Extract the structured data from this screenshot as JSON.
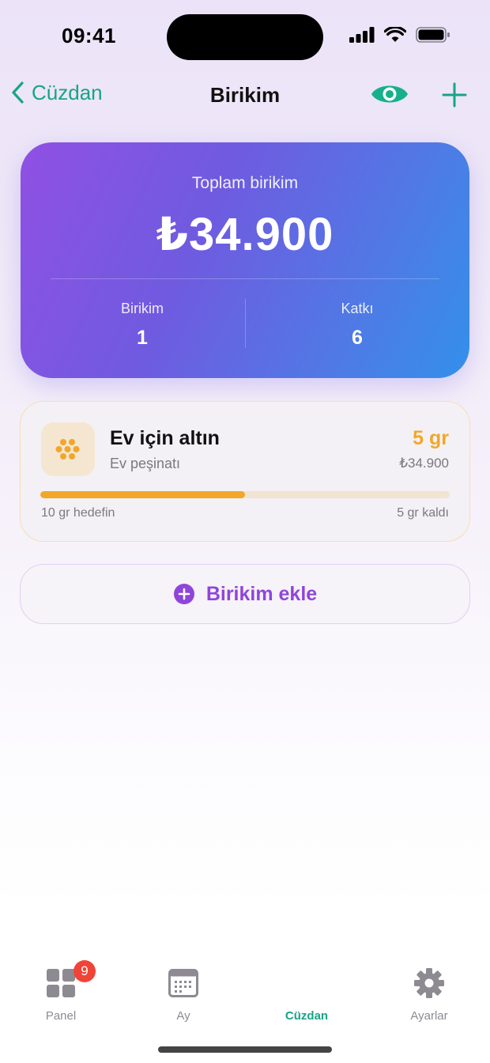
{
  "status_bar": {
    "time": "09:41"
  },
  "nav": {
    "back_label": "Cüzdan",
    "title": "Birikim"
  },
  "summary": {
    "label": "Toplam birikim",
    "amount": "₺34.900",
    "stats": [
      {
        "label": "Birikim",
        "value": "1"
      },
      {
        "label": "Katkı",
        "value": "6"
      }
    ]
  },
  "savings_item": {
    "title": "Ev için altın",
    "subtitle": "Ev peşinatı",
    "amount": "5 gr",
    "value": "₺34.900",
    "progress": 0.5,
    "goal_text": "10 gr hedefin",
    "remaining_text": "5 gr kaldı"
  },
  "add_savings": {
    "label": "Birikim ekle"
  },
  "tabs": [
    {
      "label": "Panel",
      "badge": "9",
      "icon": "grid-icon"
    },
    {
      "label": "Ay",
      "icon": "calendar-icon"
    },
    {
      "label": "Cüzdan",
      "icon": "wallet-icon",
      "active": true
    },
    {
      "label": "Ayarlar",
      "icon": "gear-icon"
    }
  ],
  "colors": {
    "accent_green": "#17a488",
    "gold": "#f2a72a",
    "purple": "#9045d9",
    "badge_red": "#f04438"
  }
}
